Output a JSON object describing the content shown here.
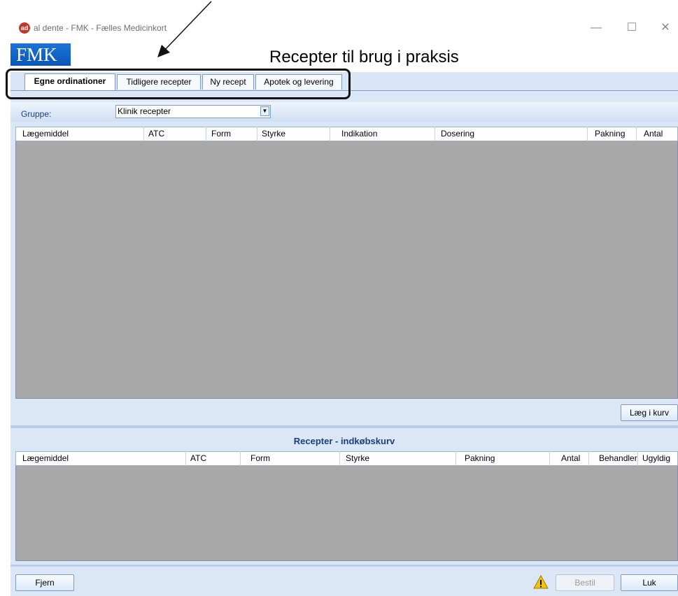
{
  "window": {
    "title": "al dente - FMK - Fælles Medicinkort",
    "icon_text": "ad",
    "controls": {
      "minimize": "—",
      "maximize": "☐",
      "close": "✕"
    }
  },
  "header": {
    "logo": "FMK",
    "title": "Recepter til brug i praksis"
  },
  "tabs": [
    {
      "label": "Egne ordinationer",
      "active": true
    },
    {
      "label": "Tidligere recepter",
      "active": false
    },
    {
      "label": "Ny recept",
      "active": false
    },
    {
      "label": "Apotek og levering",
      "active": false
    }
  ],
  "group": {
    "label": "Gruppe:",
    "value": "Klinik recepter"
  },
  "orders_table": {
    "columns": [
      "Lægemiddel",
      "ATC",
      "Form",
      "Styrke",
      "Indikation",
      "Dosering",
      "Pakning",
      "Antal"
    ],
    "rows": []
  },
  "add_to_basket_label": "Læg i kurv",
  "basket": {
    "title": "Recepter - indkøbskurv",
    "columns": [
      "Lægemiddel",
      "ATC",
      "Form",
      "Styrke",
      "Pakning",
      "Antal",
      "Behandler",
      "Ugyldig"
    ],
    "rows": []
  },
  "footer": {
    "remove_label": "Fjern",
    "order_label": "Bestil",
    "close_label": "Luk"
  },
  "colors": {
    "accent": "#1b74d8",
    "grid_bg": "#a9a9a9",
    "panel_bg": "#dbe7f6",
    "annotation": "#111111"
  }
}
